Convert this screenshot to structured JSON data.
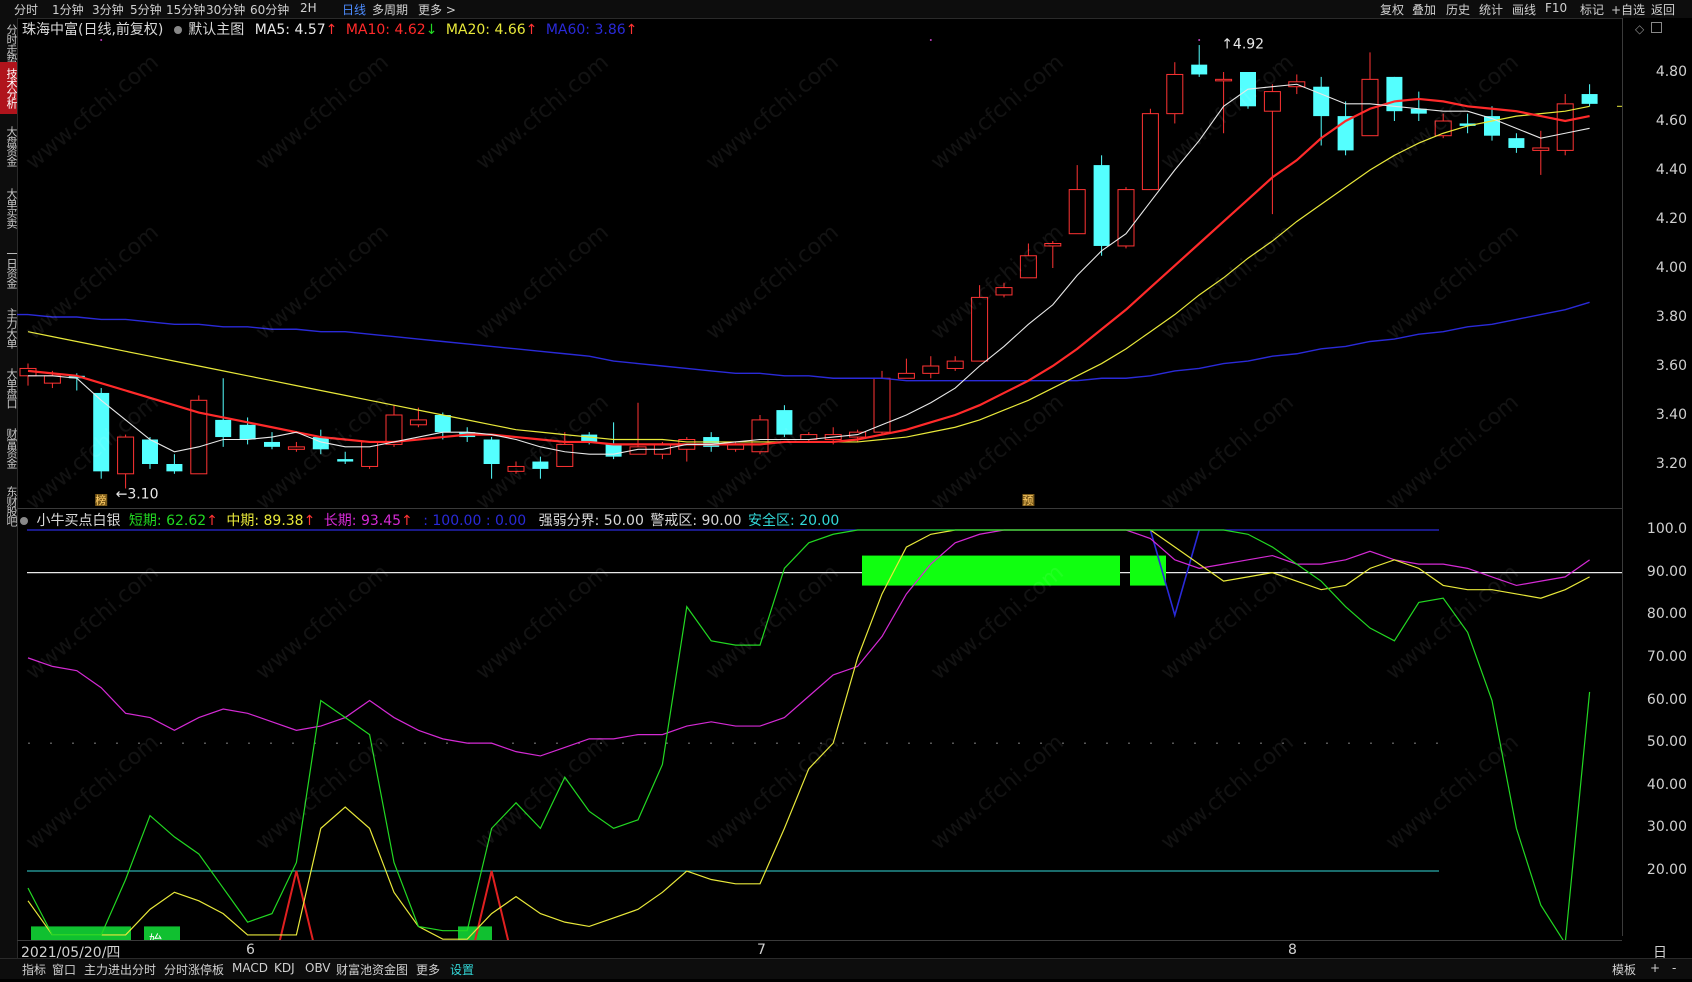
{
  "toolbar": {
    "periods": [
      "分时",
      "1分钟",
      "3分钟",
      "5分钟",
      "15分钟",
      "30分钟",
      "60分钟",
      "2H",
      "日线",
      "多周期",
      "更多 >"
    ],
    "active_period": "日线",
    "right_tools": [
      "复权",
      "叠加",
      "历史",
      "统计",
      "画线",
      "F10",
      "标记",
      "+自选",
      "返回"
    ]
  },
  "left_tabs": [
    {
      "label": "分时走势",
      "active": false
    },
    {
      "label": "技术分析",
      "active": true
    },
    {
      "label": "大盘资金",
      "active": false
    },
    {
      "label": "大单买卖",
      "active": false
    },
    {
      "label": "一日资金",
      "active": false
    },
    {
      "label": "主力大单",
      "active": false
    },
    {
      "label": "大单盘口",
      "active": false
    },
    {
      "label": "财富资金",
      "active": false
    },
    {
      "label": "东财股吧",
      "active": false
    }
  ],
  "main_header": {
    "title": "珠海中富(日线,前复权)",
    "chart_mode": "默认主图",
    "ma5": "MA5: 4.57",
    "ma5_arrow": "↑",
    "ma10": "MA10: 4.62",
    "ma10_arrow": "↓",
    "ma20": "MA20: 4.66",
    "ma20_arrow": "↑",
    "ma60": "MA60: 3.86",
    "ma60_arrow": "↑"
  },
  "price_axis": [
    "4.80",
    "4.60",
    "4.40",
    "4.20",
    "4.00",
    "3.80",
    "3.60",
    "3.40",
    "3.20"
  ],
  "annotations": {
    "high": "4.92",
    "low": "3.10",
    "marker1": "榜",
    "marker2": "预",
    "start": "始"
  },
  "indicator_header": {
    "name": "小牛买点白银",
    "short": "短期: 62.62",
    "short_arrow": "↑",
    "mid": "中期: 89.38",
    "mid_arrow": "↑",
    "long": "长期: 93.45",
    "long_arrow": "↑",
    "extra": ": 100.00 : 0.00",
    "strong_weak": "强弱分界: 50.00",
    "alert": "警戒区: 90.00",
    "safe": "安全区: 20.00"
  },
  "indicator_axis": [
    "100.0",
    "90.00",
    "80.00",
    "70.00",
    "60.00",
    "50.00",
    "40.00",
    "30.00",
    "20.00"
  ],
  "date_axis": {
    "first_date": "2021/05/20/四",
    "months": [
      "6",
      "7",
      "8"
    ],
    "period_label": "日线"
  },
  "bottom_tabs": [
    "指标",
    "窗口",
    "主力进出分时",
    "分时涨停板",
    "MACD",
    "KDJ",
    "OBV",
    "财富池资金图",
    "更多",
    "设置"
  ],
  "bottom_right": [
    "模板",
    "+",
    "-"
  ],
  "watermark": "www.cfchi.com",
  "colors": {
    "up": "#ff3333",
    "down": "#54ffff",
    "ma5": "#e8e8e8",
    "ma10": "#ff2a2a",
    "ma20": "#e8e83a",
    "ma60": "#2a2ad8",
    "short": "#22d822",
    "mid": "#e8e83a",
    "long": "#d42ad4",
    "bg": "#000000"
  },
  "chart_data": {
    "type": "candlestick",
    "candles": [
      [
        3.56,
        3.59,
        3.61,
        3.52
      ],
      [
        3.53,
        3.56,
        3.58,
        3.51
      ],
      [
        3.56,
        3.55,
        3.57,
        3.5
      ],
      [
        3.49,
        3.17,
        3.51,
        3.14
      ],
      [
        3.16,
        3.31,
        3.32,
        3.1
      ],
      [
        3.3,
        3.2,
        3.31,
        3.18
      ],
      [
        3.2,
        3.17,
        3.24,
        3.16
      ],
      [
        3.16,
        3.46,
        3.48,
        3.16
      ],
      [
        3.38,
        3.31,
        3.55,
        3.27
      ],
      [
        3.36,
        3.3,
        3.39,
        3.28
      ],
      [
        3.29,
        3.27,
        3.33,
        3.26
      ],
      [
        3.26,
        3.27,
        3.29,
        3.25
      ],
      [
        3.31,
        3.26,
        3.34,
        3.24
      ],
      [
        3.22,
        3.21,
        3.25,
        3.2
      ],
      [
        3.19,
        3.29,
        3.29,
        3.18
      ],
      [
        3.28,
        3.4,
        3.44,
        3.27
      ],
      [
        3.36,
        3.38,
        3.43,
        3.35
      ],
      [
        3.4,
        3.33,
        3.41,
        3.3
      ],
      [
        3.33,
        3.31,
        3.35,
        3.29
      ],
      [
        3.3,
        3.2,
        3.31,
        3.14
      ],
      [
        3.17,
        3.19,
        3.21,
        3.16
      ],
      [
        3.21,
        3.18,
        3.23,
        3.14
      ],
      [
        3.19,
        3.28,
        3.33,
        3.19
      ],
      [
        3.32,
        3.29,
        3.33,
        3.28
      ],
      [
        3.28,
        3.23,
        3.37,
        3.22
      ],
      [
        3.24,
        3.27,
        3.45,
        3.24
      ],
      [
        3.24,
        3.28,
        3.29,
        3.22
      ],
      [
        3.26,
        3.3,
        3.31,
        3.21
      ],
      [
        3.31,
        3.27,
        3.33,
        3.25
      ],
      [
        3.26,
        3.28,
        3.29,
        3.25
      ],
      [
        3.25,
        3.38,
        3.4,
        3.24
      ],
      [
        3.42,
        3.32,
        3.44,
        3.31
      ],
      [
        3.3,
        3.32,
        3.33,
        3.29
      ],
      [
        3.3,
        3.32,
        3.35,
        3.28
      ],
      [
        3.31,
        3.33,
        3.34,
        3.29
      ],
      [
        3.33,
        3.55,
        3.58,
        3.32
      ],
      [
        3.55,
        3.57,
        3.63,
        3.55
      ],
      [
        3.57,
        3.6,
        3.64,
        3.55
      ],
      [
        3.59,
        3.62,
        3.64,
        3.58
      ],
      [
        3.62,
        3.88,
        3.93,
        3.62
      ],
      [
        3.89,
        3.92,
        3.94,
        3.88
      ],
      [
        3.96,
        4.05,
        4.1,
        3.96
      ],
      [
        4.09,
        4.1,
        4.11,
        4.0
      ],
      [
        4.14,
        4.32,
        4.42,
        4.14
      ],
      [
        4.42,
        4.09,
        4.46,
        4.05
      ],
      [
        4.09,
        4.32,
        4.33,
        4.08
      ],
      [
        4.32,
        4.63,
        4.65,
        4.32
      ],
      [
        4.63,
        4.79,
        4.84,
        4.59
      ],
      [
        4.83,
        4.79,
        4.91,
        4.78
      ],
      [
        4.77,
        4.77,
        4.8,
        4.55
      ],
      [
        4.8,
        4.66,
        4.8,
        4.65
      ],
      [
        4.64,
        4.72,
        4.75,
        4.22
      ],
      [
        4.74,
        4.76,
        4.79,
        4.71
      ],
      [
        4.74,
        4.62,
        4.78,
        4.5
      ],
      [
        4.62,
        4.48,
        4.68,
        4.46
      ],
      [
        4.54,
        4.77,
        4.88,
        4.54
      ],
      [
        4.78,
        4.64,
        4.78,
        4.6
      ],
      [
        4.65,
        4.63,
        4.72,
        4.6
      ],
      [
        4.54,
        4.6,
        4.63,
        4.53
      ],
      [
        4.59,
        4.58,
        4.63,
        4.55
      ],
      [
        4.62,
        4.54,
        4.66,
        4.52
      ],
      [
        4.53,
        4.49,
        4.55,
        4.47
      ],
      [
        4.48,
        4.49,
        4.56,
        4.38
      ],
      [
        4.48,
        4.67,
        4.71,
        4.46
      ],
      [
        4.71,
        4.67,
        4.75,
        4.66
      ]
    ],
    "ma5": [
      3.56,
      3.56,
      3.55,
      3.46,
      3.38,
      3.3,
      3.25,
      3.27,
      3.3,
      3.3,
      3.31,
      3.33,
      3.29,
      3.27,
      3.27,
      3.29,
      3.31,
      3.33,
      3.33,
      3.32,
      3.3,
      3.27,
      3.25,
      3.24,
      3.24,
      3.26,
      3.26,
      3.28,
      3.28,
      3.29,
      3.3,
      3.3,
      3.3,
      3.31,
      3.32,
      3.36,
      3.4,
      3.45,
      3.51,
      3.6,
      3.68,
      3.77,
      3.85,
      3.97,
      4.07,
      4.14,
      4.27,
      4.4,
      4.52,
      4.66,
      4.73,
      4.74,
      4.75,
      4.71,
      4.67,
      4.67,
      4.66,
      4.65,
      4.64,
      4.64,
      4.61,
      4.57,
      4.53,
      4.55,
      4.57
    ],
    "ma10": [
      3.58,
      3.57,
      3.56,
      3.53,
      3.5,
      3.47,
      3.44,
      3.41,
      3.39,
      3.37,
      3.35,
      3.33,
      3.31,
      3.3,
      3.29,
      3.29,
      3.3,
      3.31,
      3.32,
      3.32,
      3.31,
      3.3,
      3.29,
      3.29,
      3.28,
      3.28,
      3.28,
      3.28,
      3.28,
      3.28,
      3.28,
      3.29,
      3.29,
      3.29,
      3.3,
      3.32,
      3.34,
      3.37,
      3.4,
      3.44,
      3.49,
      3.54,
      3.6,
      3.67,
      3.75,
      3.83,
      3.92,
      4.01,
      4.1,
      4.19,
      4.28,
      4.37,
      4.44,
      4.53,
      4.6,
      4.65,
      4.68,
      4.69,
      4.68,
      4.66,
      4.65,
      4.64,
      4.62,
      4.6,
      4.62
    ],
    "ma20": [
      3.74,
      3.72,
      3.7,
      3.68,
      3.66,
      3.64,
      3.62,
      3.6,
      3.58,
      3.56,
      3.54,
      3.52,
      3.5,
      3.48,
      3.46,
      3.44,
      3.42,
      3.4,
      3.38,
      3.36,
      3.34,
      3.33,
      3.32,
      3.31,
      3.3,
      3.3,
      3.3,
      3.29,
      3.29,
      3.29,
      3.29,
      3.29,
      3.29,
      3.29,
      3.29,
      3.3,
      3.31,
      3.33,
      3.35,
      3.38,
      3.42,
      3.46,
      3.51,
      3.56,
      3.61,
      3.67,
      3.74,
      3.81,
      3.89,
      3.96,
      4.04,
      4.11,
      4.19,
      4.26,
      4.33,
      4.4,
      4.46,
      4.51,
      4.55,
      4.58,
      4.6,
      4.62,
      4.63,
      4.64,
      4.66
    ],
    "ma60": [
      3.81,
      3.8,
      3.8,
      3.79,
      3.79,
      3.78,
      3.77,
      3.77,
      3.76,
      3.76,
      3.75,
      3.75,
      3.74,
      3.74,
      3.73,
      3.72,
      3.71,
      3.7,
      3.69,
      3.68,
      3.67,
      3.66,
      3.65,
      3.64,
      3.62,
      3.61,
      3.6,
      3.59,
      3.58,
      3.57,
      3.57,
      3.56,
      3.56,
      3.55,
      3.55,
      3.55,
      3.54,
      3.54,
      3.54,
      3.54,
      3.54,
      3.54,
      3.54,
      3.54,
      3.55,
      3.55,
      3.56,
      3.58,
      3.59,
      3.61,
      3.62,
      3.64,
      3.65,
      3.67,
      3.68,
      3.7,
      3.71,
      3.73,
      3.74,
      3.76,
      3.77,
      3.79,
      3.81,
      3.83,
      3.86
    ],
    "short": [
      16,
      5,
      5,
      5,
      18,
      33,
      28,
      24,
      16,
      8,
      10,
      22,
      60,
      56,
      52,
      22,
      7,
      6,
      6,
      30,
      36,
      30,
      42,
      34,
      30,
      32,
      45,
      82,
      74,
      73,
      73,
      91,
      97,
      99,
      100,
      100,
      100,
      100,
      100,
      100,
      100,
      100,
      100,
      100,
      100,
      100,
      100,
      100,
      100,
      100,
      99,
      96,
      92,
      88,
      82,
      77,
      74,
      83,
      84,
      76,
      60,
      30,
      12,
      3,
      62
    ],
    "mid": [
      13,
      5,
      5,
      5,
      5,
      11,
      15,
      13,
      10,
      5,
      5,
      5,
      30,
      35,
      30,
      15,
      7,
      4,
      4,
      10,
      14,
      10,
      8,
      7,
      9,
      11,
      15,
      20,
      18,
      17,
      17,
      30,
      44,
      50,
      70,
      85,
      96,
      99,
      100,
      100,
      100,
      100,
      100,
      100,
      100,
      100,
      100,
      96,
      92,
      88,
      89,
      90,
      88,
      86,
      87,
      91,
      93,
      91,
      87,
      86,
      86,
      85,
      84,
      86,
      89
    ],
    "long": [
      70,
      68,
      67,
      63,
      57,
      56,
      53,
      56,
      58,
      57,
      55,
      53,
      54,
      56,
      60,
      56,
      53,
      51,
      50,
      50,
      48,
      47,
      49,
      51,
      51,
      52,
      52,
      54,
      55,
      54,
      54,
      56,
      61,
      66,
      68,
      75,
      85,
      92,
      97,
      99,
      100,
      100,
      100,
      100,
      100,
      100,
      98,
      93,
      91,
      92,
      93,
      94,
      92,
      92,
      93,
      95,
      93,
      92,
      92,
      91,
      89,
      87,
      88,
      89,
      93
    ],
    "ylim_price": [
      3.1,
      4.92
    ],
    "ylim_indicator": [
      0,
      100
    ]
  }
}
